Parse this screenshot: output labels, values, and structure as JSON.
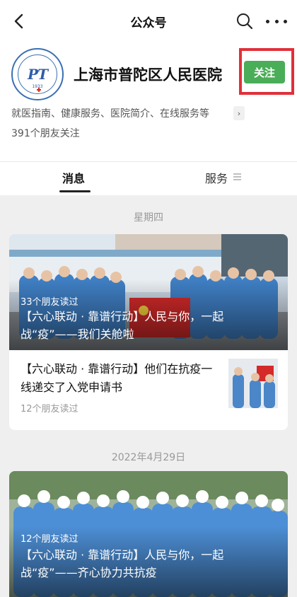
{
  "nav": {
    "title": "公众号"
  },
  "account": {
    "name": "上海市普陀区人民医院",
    "follow_label": "关注",
    "description": "就医指南、健康服务、医院简介、在线服务等",
    "followers": "391个朋友关注",
    "logo_year": "1933",
    "logo_monogram": "PT"
  },
  "tabs": {
    "messages": "消息",
    "service": "服务"
  },
  "feed": [
    {
      "date": "星期四",
      "hero": {
        "read_count": "33个朋友读过",
        "title": "【六心联动 · 靠谱行动】人民与你，一起战“疫”——我们关舱啦"
      },
      "sub": {
        "title": "【六心联动 · 靠谱行动】他们在抗疫一线递交了入党申请书",
        "read_count": "12个朋友读过"
      }
    },
    {
      "date": "2022年4月29日",
      "hero": {
        "read_count": "12个朋友读过",
        "title": "【六心联动 · 靠谱行动】人民与你，一起战“疫”——齐心协力共抗疫"
      }
    }
  ],
  "colors": {
    "follow_green": "#4aad57",
    "highlight_red": "#e0303a",
    "logo_blue": "#2f5ea8"
  },
  "icons": [
    "back-icon",
    "search-icon",
    "more-icon",
    "chevron-right-icon",
    "menu-icon"
  ]
}
